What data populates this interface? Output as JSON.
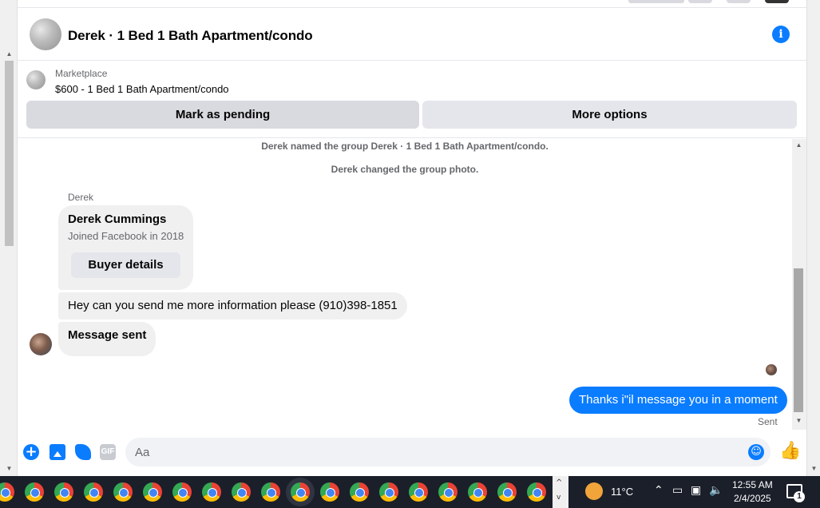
{
  "conversation": {
    "title": "Derek · 1 Bed 1 Bath Apartment/condo",
    "info_icon": "info-icon"
  },
  "marketplace": {
    "label": "Marketplace",
    "listing": "$600 - 1 Bed 1 Bath Apartment/condo",
    "mark_pending_label": "Mark as pending",
    "more_options_label": "More options"
  },
  "thread": {
    "system_messages": [
      "Derek named the group Derek · 1 Bed 1 Bath Apartment/condo.",
      "Derek changed the group photo."
    ],
    "sender_name": "Derek",
    "profile_card": {
      "name": "Derek Cummings",
      "subtitle": "Joined Facebook in 2018",
      "button_label": "Buyer details"
    },
    "incoming_messages": [
      "Hey can you send me more information please (910)398-1851",
      "Message sent"
    ],
    "outgoing_message": "Thanks i\"il message you in a moment",
    "status": "Sent"
  },
  "composer": {
    "placeholder": "Aa",
    "gif_label": "GIF",
    "icons": [
      "plus-icon",
      "photo-icon",
      "sticker-icon",
      "gif-icon",
      "emoji-icon",
      "thumbs-up-icon"
    ]
  },
  "colors": {
    "accent": "#0a7cff",
    "bubble_gray": "#f0f0f0",
    "taskbar": "#1b1f2a"
  },
  "taskbar": {
    "app_icon": "chrome-icon",
    "weather": "11°C",
    "time": "12:55 AM",
    "date": "2/4/2025",
    "notification_count": "1"
  }
}
